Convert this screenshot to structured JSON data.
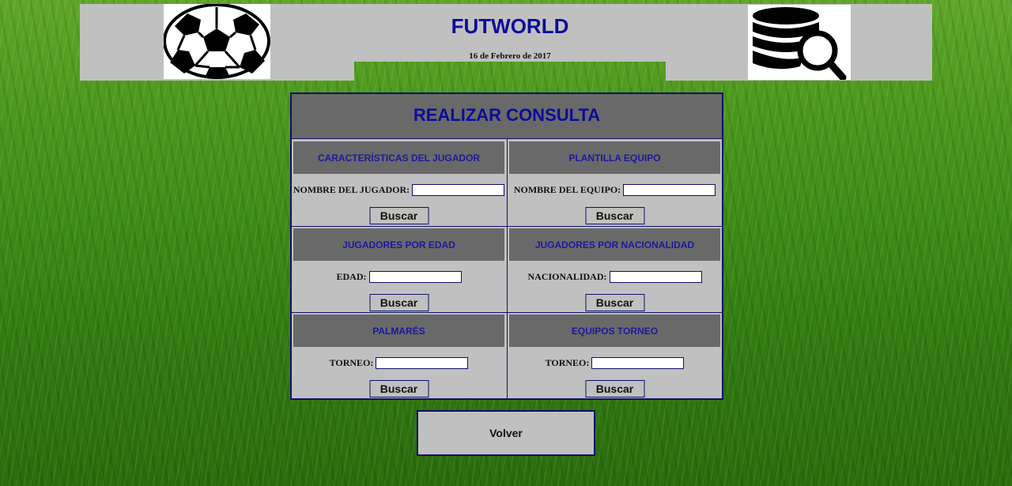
{
  "header": {
    "title": "FUTWORLD",
    "date": "16 de Febrero de 2017",
    "left_logo": "soccer-ball-icon",
    "right_logo": "database-search-icon"
  },
  "panel": {
    "title": "REALIZAR CONSULTA",
    "sections": [
      {
        "heading": "CARACTERÍSTICAS DEL JUGADOR",
        "label": "NOMBRE DEL JUGADOR:",
        "value": "",
        "button": "Buscar"
      },
      {
        "heading": "PLANTILLA EQUIPO",
        "label": "NOMBRE DEL EQUIPO:",
        "value": "",
        "button": "Buscar"
      },
      {
        "heading": "JUGADORES POR EDAD",
        "label": "EDAD:",
        "value": "",
        "button": "Buscar"
      },
      {
        "heading": "JUGADORES POR NACIONALIDAD",
        "label": "NACIONALIDAD:",
        "value": "",
        "button": "Buscar"
      },
      {
        "heading": "PALMARÉS",
        "label": "TORNEO:",
        "value": "",
        "button": "Buscar"
      },
      {
        "heading": "EQUIPOS TORNEO",
        "label": "TORNEO:",
        "value": "",
        "button": "Buscar"
      }
    ]
  },
  "footer": {
    "back_label": "Volver"
  },
  "colors": {
    "accent": "#0c0c9a",
    "panel_bg": "#c0c0c0",
    "header_cell_bg": "#696969",
    "border": "#10106a"
  }
}
